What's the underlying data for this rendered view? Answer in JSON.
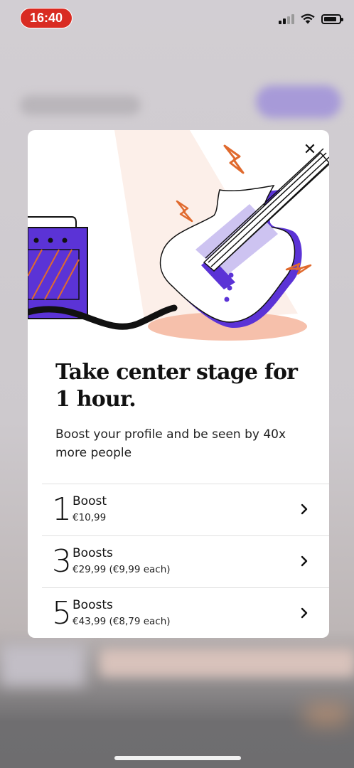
{
  "status_bar": {
    "time": "16:40",
    "icons": [
      "cellular-signal-icon",
      "wifi-icon",
      "battery-icon"
    ]
  },
  "modal": {
    "close_icon": "close-icon",
    "hero_illustration": "electric-guitar-and-amplifier-illustration",
    "headline": "Take center stage for 1 hour.",
    "subtext": "Boost your profile and be seen by 40x more people",
    "options": [
      {
        "count": "1",
        "name": "Boost",
        "price": "€10,99"
      },
      {
        "count": "3",
        "name": "Boosts",
        "price": "€29,99 (€9,99 each)"
      },
      {
        "count": "5",
        "name": "Boosts",
        "price": "€43,99 (€8,79 each)"
      }
    ]
  },
  "colors": {
    "accent_purple": "#5b33d6",
    "accent_orange": "#e06a2e",
    "spotlight": "#fcefe9",
    "status_red": "#d92b22"
  }
}
